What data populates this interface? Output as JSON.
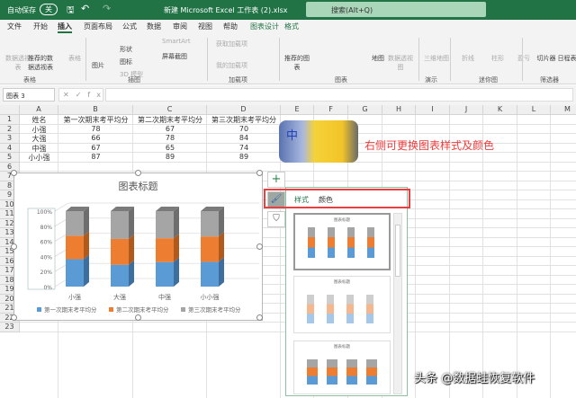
{
  "titlebar": {
    "autosave": "自动保存",
    "autosave_state": "关",
    "filename": "新建 Microsoft Excel 工作表 (2).xlsx",
    "search_placeholder": "搜索(Alt+Q)"
  },
  "tabs": [
    "文件",
    "开始",
    "插入",
    "页面布局",
    "公式",
    "数据",
    "审阅",
    "视图",
    "帮助",
    "图表设计",
    "格式"
  ],
  "ribbon": {
    "buttons": [
      "数据透视表",
      "推荐的数据透视表",
      "表格",
      "图片",
      "形状",
      "图标",
      "3D 模型",
      "SmartArt",
      "屏幕截图",
      "获取加载项",
      "我的加载项",
      "推荐的图表",
      "地图",
      "数据透视图",
      "三维地图",
      "折线",
      "柱形",
      "盈亏",
      "切片器",
      "日程表"
    ],
    "groups": [
      "表格",
      "插图",
      "加载项",
      "图表",
      "演示",
      "迷你图",
      "筛选器"
    ]
  },
  "formula_bar": {
    "name_box": "图表 3",
    "fx": "fx",
    "value": ""
  },
  "columns": [
    "A",
    "B",
    "C",
    "D",
    "E",
    "F",
    "G",
    "H",
    "I",
    "J",
    "K",
    "L",
    "M"
  ],
  "rows": [
    "1",
    "2",
    "3",
    "4",
    "5",
    "6",
    "7",
    "8",
    "9",
    "10",
    "11",
    "12",
    "13",
    "14",
    "15",
    "16",
    "17",
    "18",
    "19",
    "20",
    "21",
    "22",
    "23"
  ],
  "table": {
    "headers": [
      "姓名",
      "第一次期末考平均分",
      "第二次期末考平均分",
      "第三次期末考平均分"
    ],
    "rows": [
      [
        "小强",
        "78",
        "67",
        "70"
      ],
      [
        "大强",
        "66",
        "78",
        "84"
      ],
      [
        "中强",
        "67",
        "65",
        "74"
      ],
      [
        "小小强",
        "87",
        "89",
        "89"
      ]
    ]
  },
  "chart_data": {
    "type": "bar",
    "stacked": "percent",
    "title": "图表标题",
    "categories": [
      "小强",
      "大强",
      "中强",
      "小小强"
    ],
    "series": [
      {
        "name": "第一次期末考平均分",
        "values": [
          78,
          66,
          67,
          87
        ],
        "color": "#5b9bd5"
      },
      {
        "name": "第二次期末考平均分",
        "values": [
          67,
          78,
          65,
          89
        ],
        "color": "#ed7d31"
      },
      {
        "name": "第三次期末考平均分",
        "values": [
          70,
          84,
          74,
          89
        ],
        "color": "#a5a5a5"
      }
    ],
    "yticks": [
      "0%",
      "20%",
      "40%",
      "60%",
      "80%",
      "100%"
    ],
    "ylim": [
      0,
      100
    ],
    "legend": "bottom"
  },
  "panel": {
    "tabs": [
      "样式",
      "颜色"
    ],
    "thumb_titles": [
      "图表标题",
      "图表标题",
      "图表标题"
    ]
  },
  "annotation": "右侧可更换图表样式及颜色",
  "pika_char": "中",
  "watermark": "头条 @数据蛙恢复软件",
  "colors": {
    "accent": "#217346",
    "annotation": "#f03c3c"
  }
}
